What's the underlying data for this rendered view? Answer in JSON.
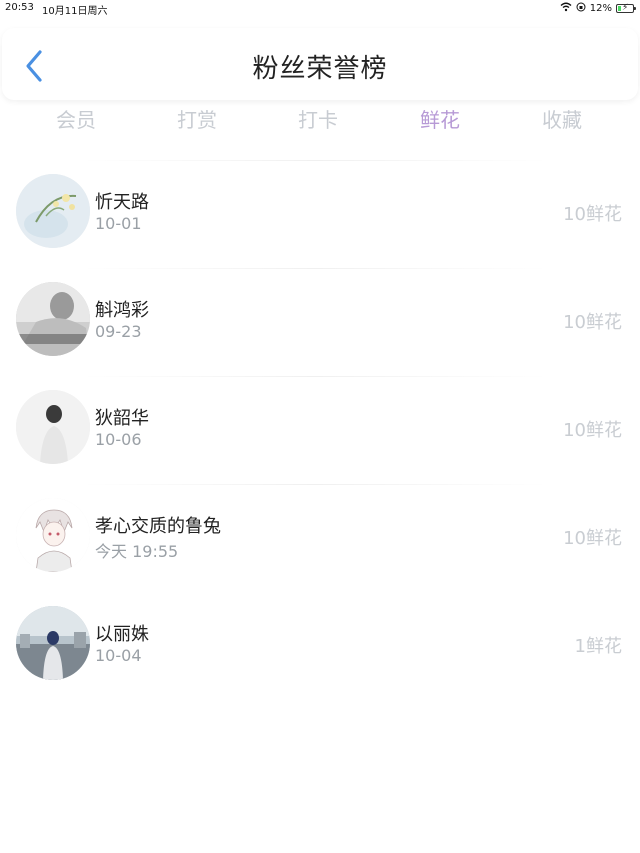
{
  "status_bar": {
    "time": "20:53",
    "date": "10月11日周六",
    "battery": "12%",
    "battery_level_percent": 12
  },
  "header": {
    "title": "粉丝荣誉榜",
    "back_icon": "chevron-left-icon",
    "accent_color": "#4a90e2"
  },
  "tabs": [
    {
      "label": "会员"
    },
    {
      "label": "打赏"
    },
    {
      "label": "打卡"
    },
    {
      "label": "鲜花",
      "active": true
    },
    {
      "label": "收藏"
    }
  ],
  "colors": {
    "tab_inactive": "#c8ccd2",
    "tab_active": "#b79ad6",
    "value_text": "#c9cdd2"
  },
  "fans": [
    {
      "name": "忻天路",
      "date": "10-01",
      "value": "10鲜花"
    },
    {
      "name": "斛鸿彩",
      "date": "09-23",
      "value": "10鲜花"
    },
    {
      "name": "狄韶华",
      "date": "10-06",
      "value": "10鲜花"
    },
    {
      "name": "孝心交质的鲁兔",
      "date": "今天 19:55",
      "value": "10鲜花"
    },
    {
      "name": "以丽姝",
      "date": "10-04",
      "value": "1鲜花"
    }
  ]
}
